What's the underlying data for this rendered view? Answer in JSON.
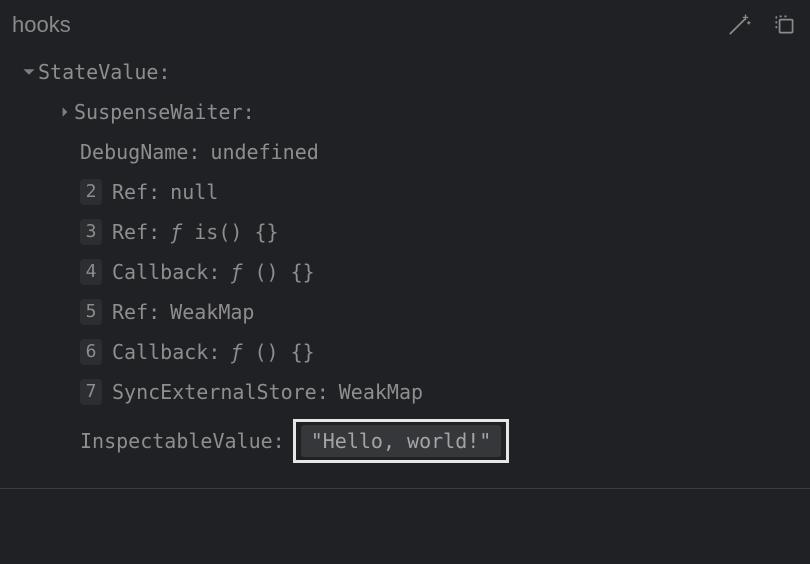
{
  "header": {
    "title": "hooks"
  },
  "tree": {
    "root": {
      "name": "StateValue",
      "colon": ":"
    },
    "children": [
      {
        "name": "SuspenseWaiter",
        "colon": ":",
        "expandable": true
      },
      {
        "name": "DebugName",
        "colon": ":",
        "value": "undefined"
      }
    ],
    "indexed": [
      {
        "index": "2",
        "name": "Ref",
        "colon": ":",
        "value": "null"
      },
      {
        "index": "3",
        "name": "Ref",
        "colon": ":",
        "fn_prefix": "ƒ",
        "value": " is() {}"
      },
      {
        "index": "4",
        "name": "Callback",
        "colon": ":",
        "fn_prefix": "ƒ",
        "value": " () {}"
      },
      {
        "index": "5",
        "name": "Ref",
        "colon": ":",
        "value": "WeakMap"
      },
      {
        "index": "6",
        "name": "Callback",
        "colon": ":",
        "fn_prefix": "ƒ",
        "value": " () {}"
      },
      {
        "index": "7",
        "name": "SyncExternalStore",
        "colon": ":",
        "value": "WeakMap"
      }
    ],
    "inspectable": {
      "name": "InspectableValue",
      "colon": ":",
      "value": "\"Hello, world!\""
    }
  }
}
